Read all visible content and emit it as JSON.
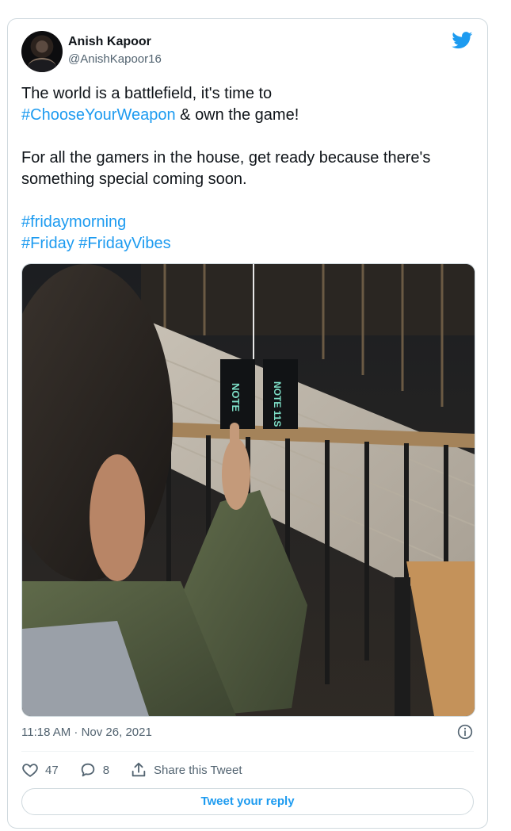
{
  "tweet": {
    "author_name": "Anish Kapoor",
    "author_handle": "@AnishKapoor16",
    "line1": "The world is a battlefield, it's time to",
    "line2_tag": "#ChooseYourWeapon",
    "line2_rest": " & own the game!",
    "paragraph2_line1": "For all the gamers in the house, get ready because there's",
    "paragraph2_line2": "something special coming soon.",
    "hashtag_fridaymorning": "#fridaymorning",
    "hashtag_friday": "#Friday",
    "hashtag_fridayvibes": "#FridayVibes",
    "timestamp": "11:18 AM · Nov 26, 2021"
  },
  "media": {
    "box_left_label": "NOTE",
    "box_right_label": "NOTE 11S"
  },
  "actions": {
    "likes": "47",
    "replies": "8",
    "share_label": "Share this Tweet",
    "reply_button_label": "Tweet your reply"
  },
  "colors": {
    "accent": "#1d9bf0",
    "secondary_text": "#536471",
    "border": "#cfd9de"
  },
  "icons": {
    "logo": "twitter-bird-icon",
    "info": "info-icon",
    "like": "heart-icon",
    "reply": "reply-bubble-icon",
    "share": "share-upload-icon"
  }
}
